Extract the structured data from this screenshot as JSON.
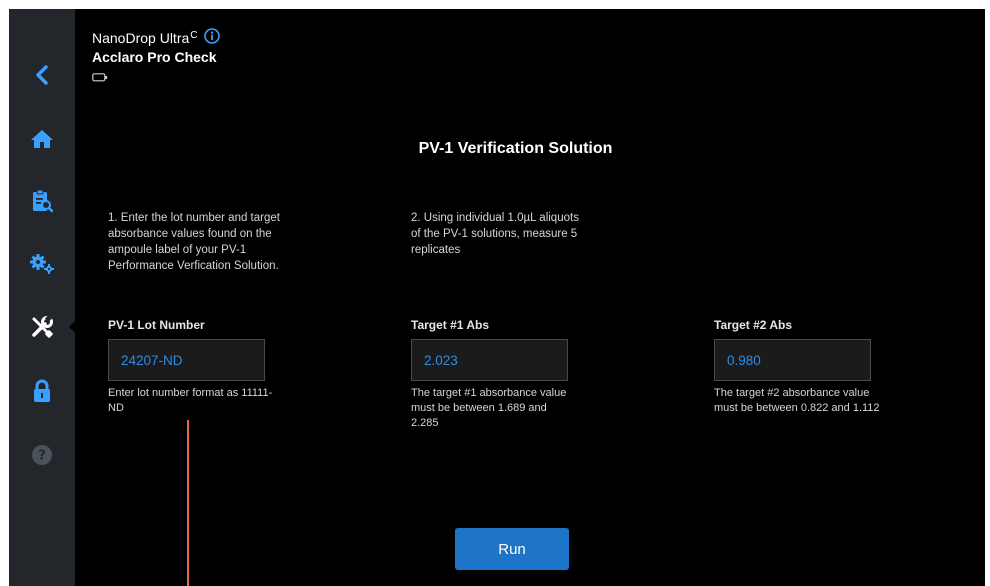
{
  "header": {
    "device_name": "NanoDrop Ultra",
    "device_superscript": "C",
    "app_name": "Acclaro Pro Check"
  },
  "sidebar": {
    "items": [
      {
        "icon": "back-chevron-icon"
      },
      {
        "icon": "home-icon"
      },
      {
        "icon": "clipboard-search-icon"
      },
      {
        "icon": "gears-icon"
      },
      {
        "icon": "tools-icon",
        "active": true
      },
      {
        "icon": "lock-icon"
      },
      {
        "icon": "help-icon"
      }
    ]
  },
  "main": {
    "title": "PV-1 Verification Solution",
    "step1": "1. Enter the lot number and target absorbance values found on the ampoule label of your PV-1 Performance Verfication Solution.",
    "step2": "2. Using individual 1.0µL aliquots of the PV-1 solutions, measure 5 replicates",
    "fields": [
      {
        "label": "PV-1 Lot Number",
        "value": "24207-ND",
        "help": "Enter lot number format as 11111-ND"
      },
      {
        "label": "Target #1 Abs",
        "value": "2.023",
        "help": "The target #1 absorbance value must be between 1.689 and 2.285"
      },
      {
        "label": "Target #2 Abs",
        "value": "0.980",
        "help": "The target #2 absorbance value must be between 0.822 and 1.112"
      }
    ],
    "run_label": "Run"
  },
  "colors": {
    "accent": "#2f8be6",
    "button": "#1e74c7",
    "sidebar_bg": "#23272b",
    "annotation_line": "#e66a3c"
  }
}
